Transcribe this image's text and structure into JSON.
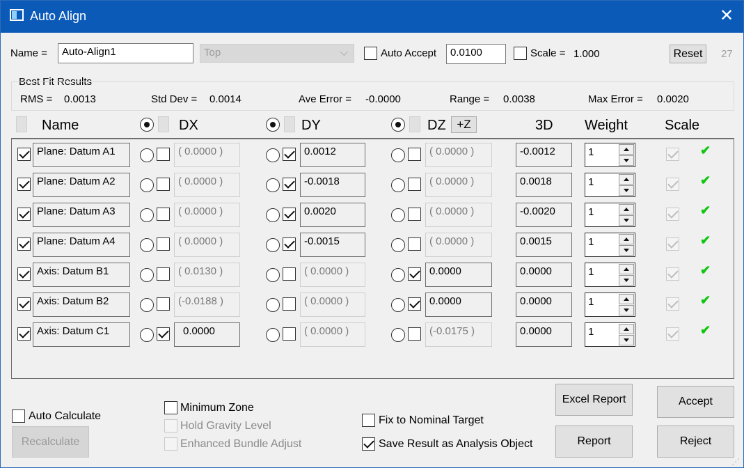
{
  "window": {
    "title": "Auto Align",
    "close_glyph": "✕",
    "icon": "window-app-icon"
  },
  "top": {
    "name_label": "Name =",
    "name_value": "Auto-Align1",
    "view_select": "Top",
    "auto_accept_label": "Auto Accept",
    "auto_accept_value": "0.0100",
    "scale_label": "Scale =",
    "scale_value": "1.000",
    "reset_label": "Reset",
    "count": "27"
  },
  "best_fit": {
    "title": "Best Fit Results",
    "rms_label": "RMS =",
    "rms_value": "0.0013",
    "stddev_label": "Std Dev =",
    "stddev_value": "0.0014",
    "aveerr_label": "Ave Error =",
    "aveerr_value": "-0.0000",
    "range_label": "Range =",
    "range_value": "0.0038",
    "maxerr_label": "Max Error =",
    "maxerr_value": "0.0020"
  },
  "headers": {
    "name": "Name",
    "dx": "DX",
    "dy": "DY",
    "dz": "DZ",
    "plusz": "+Z",
    "d3": "3D",
    "weight": "Weight",
    "scale": "Scale"
  },
  "rows": [
    {
      "name": "Plane: Datum A1",
      "dx": "( 0.0000 )",
      "dx_on": false,
      "dy": "0.0012",
      "dy_on": true,
      "dz": "( 0.0000 )",
      "dz_on": false,
      "d3": "-0.0012",
      "weight": "1",
      "ok": "✔"
    },
    {
      "name": "Plane: Datum A2",
      "dx": "( 0.0000 )",
      "dx_on": false,
      "dy": "-0.0018",
      "dy_on": true,
      "dz": "( 0.0000 )",
      "dz_on": false,
      "d3": "0.0018",
      "weight": "1",
      "ok": "✔"
    },
    {
      "name": "Plane: Datum A3",
      "dx": "( 0.0000 )",
      "dx_on": false,
      "dy": "0.0020",
      "dy_on": true,
      "dz": "( 0.0000 )",
      "dz_on": false,
      "d3": "-0.0020",
      "weight": "1",
      "ok": "✔"
    },
    {
      "name": "Plane: Datum A4",
      "dx": "( 0.0000 )",
      "dx_on": false,
      "dy": "-0.0015",
      "dy_on": true,
      "dz": "( 0.0000 )",
      "dz_on": false,
      "d3": "0.0015",
      "weight": "1",
      "ok": "✔"
    },
    {
      "name": "Axis: Datum B1",
      "dx": "( 0.0130 )",
      "dx_on": false,
      "dy": "( 0.0000 )",
      "dy_on": false,
      "dz": "0.0000",
      "dz_on": true,
      "d3": "0.0000",
      "weight": "1",
      "ok": "✔"
    },
    {
      "name": "Axis: Datum B2",
      "dx": "(-0.0188 )",
      "dx_on": false,
      "dy": "( 0.0000 )",
      "dy_on": false,
      "dz": "0.0000",
      "dz_on": true,
      "d3": "0.0000",
      "weight": "1",
      "ok": "✔"
    },
    {
      "name": "Axis: Datum C1",
      "dx": "0.0000",
      "dx_on": true,
      "dy": "( 0.0000 )",
      "dy_on": false,
      "dz": "(-0.0175 )",
      "dz_on": false,
      "d3": "0.0000",
      "weight": "1",
      "ok": "✔"
    }
  ],
  "bottom": {
    "auto_calculate": "Auto Calculate",
    "recalculate": "Recalculate",
    "minimum_zone": "Minimum Zone",
    "hold_gravity": "Hold Gravity Level",
    "enhanced_bundle": "Enhanced Bundle Adjust",
    "fix_nominal": "Fix to Nominal Target",
    "save_result": "Save Result as Analysis Object",
    "excel_report": "Excel Report",
    "report": "Report",
    "accept": "Accept",
    "reject": "Reject"
  },
  "colors": {
    "titlebar": "#0b5ab8",
    "ok_check": "#0fc60f",
    "window_bg": "#f0f0f0"
  }
}
